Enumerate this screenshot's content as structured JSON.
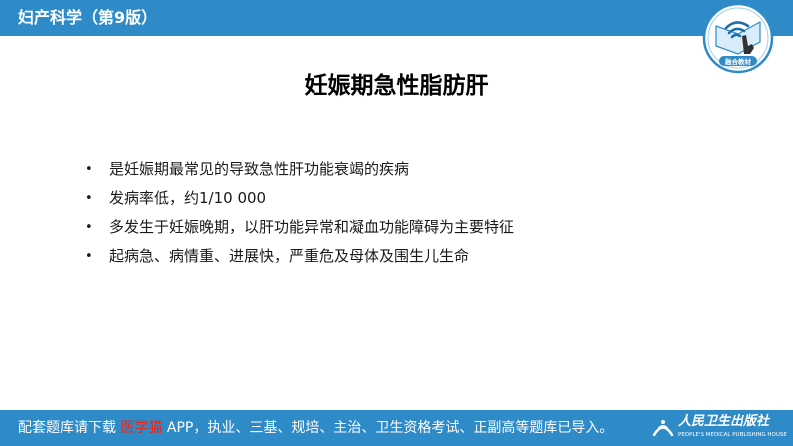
{
  "header": {
    "book_title": "妇产科学（第9版）",
    "logo_icon": "wifi-touch-book-icon",
    "logo_text": "融合教材"
  },
  "slide": {
    "title": "妊娠期急性脂肪肝",
    "bullets": [
      "是妊娠期最常见的导致急性肝功能衰竭的疾病",
      "发病率低，约1/10 000",
      "多发生于妊娠晚期，以肝功能异常和凝血功能障碍为主要特征",
      "起病急、病情重、进展快，严重危及母体及围生儿生命"
    ]
  },
  "footer": {
    "prefix": "配套题库请下载 ",
    "app_name": "医学猫",
    "suffix": " APP，执业、三基、规培、主治、卫生资格考试、正副高等题库已导入。",
    "publisher_name": "人民卫生出版社",
    "publisher_name_en": "PEOPLE'S MEDICAL PUBLISHING HOUSE"
  },
  "colors": {
    "bar_blue": "#2e8bc8",
    "highlight_red": "#e8251a"
  }
}
